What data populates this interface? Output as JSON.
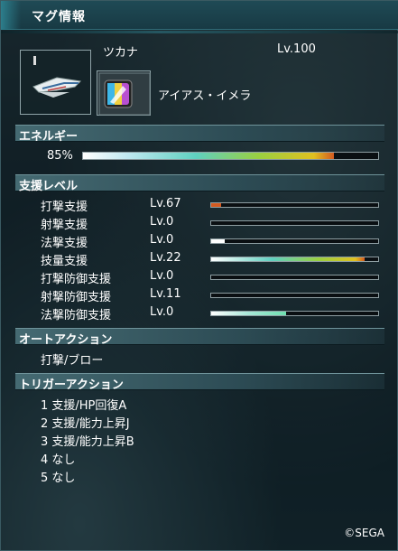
{
  "window": {
    "title": "マグ情報"
  },
  "mag": {
    "name": "ツカナ",
    "level": "Lv.100",
    "photon_blast": "アイアス・イメラ",
    "icon": "mag-bird-icon",
    "pb_icon": "photon-blast-icon"
  },
  "sections": {
    "energy": "エネルギー",
    "support_level": "支援レベル",
    "auto_action": "オートアクション",
    "trigger_action": "トリガーアクション"
  },
  "energy": {
    "value_label": "85%",
    "fraction": 0.85
  },
  "support_levels": [
    {
      "label": "打撃支援",
      "level": "Lv.67",
      "fraction": 0.06,
      "color": "#d35a20"
    },
    {
      "label": "射撃支援",
      "level": "Lv.0",
      "fraction": 0.0,
      "color": "#ffffff"
    },
    {
      "label": "法撃支援",
      "level": "Lv.0",
      "fraction": 0.08,
      "color": "#ffffff"
    },
    {
      "label": "技量支援",
      "level": "Lv.22",
      "fraction": 0.92,
      "color": "#e0c020"
    },
    {
      "label": "打撃防御支援",
      "level": "Lv.0",
      "fraction": 0.0,
      "color": "#ffffff"
    },
    {
      "label": "射撃防御支援",
      "level": "Lv.11",
      "fraction": 0.0,
      "color": "#ffffff"
    },
    {
      "label": "法撃防御支援",
      "level": "Lv.0",
      "fraction": 0.45,
      "color": "#6fe0b0"
    }
  ],
  "auto_action": {
    "value": "打撃/ブロー"
  },
  "trigger_actions": [
    "1 支援/HP回復A",
    "2 支援/能力上昇J",
    "3 支援/能力上昇B",
    "4 なし",
    "5 なし"
  ],
  "footer": {
    "copyright": "©SEGA"
  }
}
